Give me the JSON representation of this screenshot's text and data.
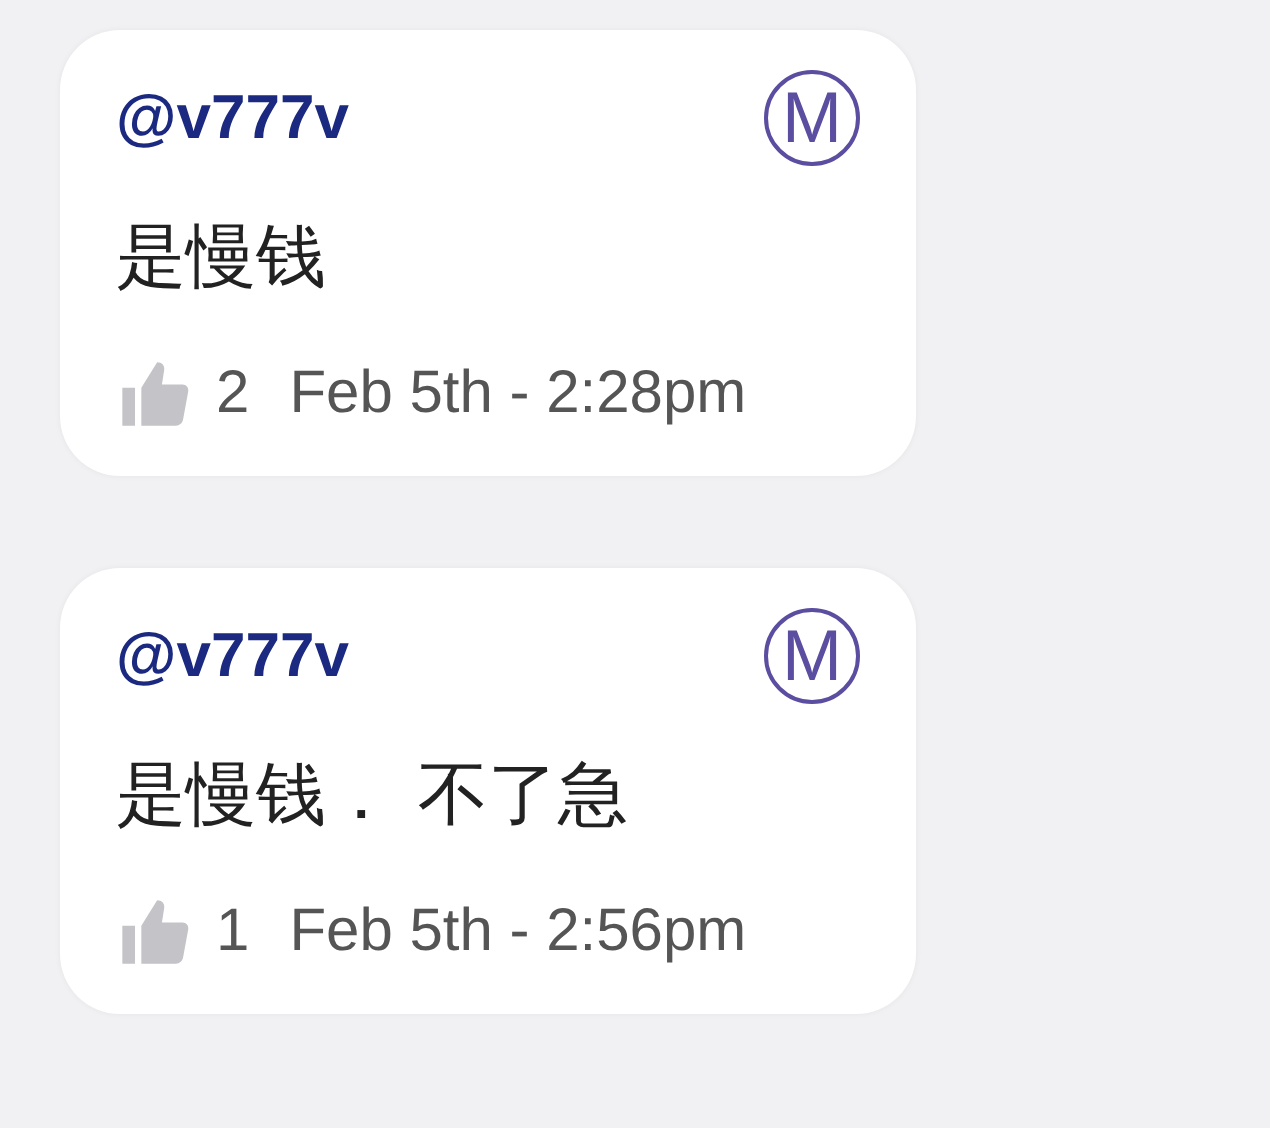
{
  "comments": [
    {
      "username": "@v777v",
      "badge": "M",
      "text": "是慢钱",
      "likes": "2",
      "date": "Feb 5th - 2:28pm"
    },
    {
      "username": "@v777v",
      "badge": "M",
      "text": "是慢钱． 不了急",
      "likes": "1",
      "date": "Feb 5th - 2:56pm"
    }
  ]
}
